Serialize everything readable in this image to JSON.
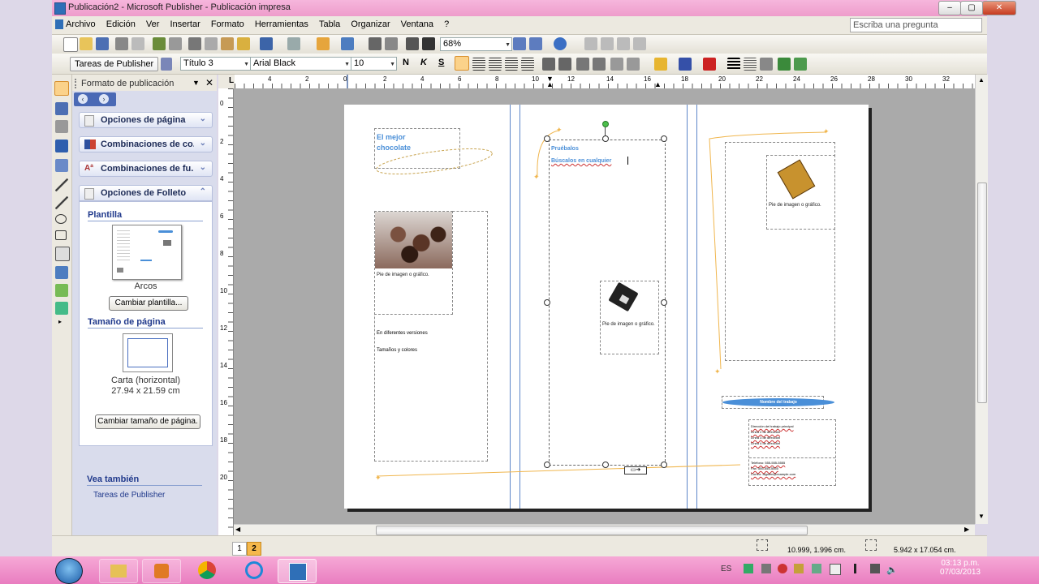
{
  "window": {
    "title": "Publicación2 - Microsoft Publisher - Publicación impresa",
    "min": "–",
    "max": "▢",
    "close": "✕"
  },
  "menu": {
    "items": [
      "Archivo",
      "Edición",
      "Ver",
      "Insertar",
      "Formato",
      "Herramientas",
      "Tabla",
      "Organizar",
      "Ventana",
      "?"
    ],
    "ask_placeholder": "Escriba una pregunta"
  },
  "standard_toolbar": {
    "zoom": "68%"
  },
  "format_toolbar": {
    "tasks_label": "Tareas de Publisher",
    "style": "Título 3",
    "font": "Arial Black",
    "size": "10",
    "bold": "N",
    "italic": "K",
    "underline": "S"
  },
  "taskpane": {
    "title": "Formato de publicación",
    "sections": [
      "Opciones de página",
      "Combinaciones de co...",
      "Combinaciones de fu...",
      "Opciones de Folleto"
    ],
    "template_heading": "Plantilla",
    "template_name": "Arcos",
    "change_template": "Cambiar plantilla...",
    "page_size_heading": "Tamaño de página",
    "page_size_name": "Carta (horizontal)",
    "page_size_dims": "27.94 x 21.59 cm",
    "change_size": "Cambiar tamaño de página.",
    "see_also": "Vea también",
    "see_also_link": "Tareas de Publisher"
  },
  "rulers": {
    "top": [
      "L",
      "4",
      "2",
      "0",
      "2",
      "4",
      "6",
      "8",
      "10",
      "12",
      "14",
      "16",
      "18",
      "20",
      "22",
      "24",
      "26",
      "28",
      "30",
      "32"
    ],
    "left": [
      "0",
      "2",
      "4",
      "6",
      "8",
      "10",
      "12",
      "14",
      "16",
      "18",
      "20"
    ]
  },
  "document": {
    "title_line1": "El mejor",
    "title_line2": "chocolate",
    "caption": "Pie de imagen o gráfico.",
    "text1": "En diferentes versiones",
    "text2": "Tamaños y colores",
    "mid_heading": "Pruébalos",
    "mid_text": "Búscalos en cualquier",
    "org_name": "Nombre del trabajo",
    "addr_lines": [
      "Dirección del trabajo principal",
      "Línea 2 de dirección",
      "Línea 3 de dirección",
      "Línea 4 de dirección"
    ],
    "contact_lines": [
      "Teléfono: 555-555-5555",
      "Fax: 555-555-5555",
      "Correo: alguien@example.com"
    ]
  },
  "status": {
    "pages": [
      "1",
      "2"
    ],
    "position": "10.999, 1.996 cm.",
    "size": "5.942 x 17.054 cm."
  },
  "taskbar": {
    "lang": "ES",
    "time": "03:13 p.m.",
    "date": "07/03/2013"
  },
  "colors": {
    "accent_blue": "#4a8fd8",
    "gold": "#f0b64e",
    "taskbar": "#ee8fc8"
  }
}
